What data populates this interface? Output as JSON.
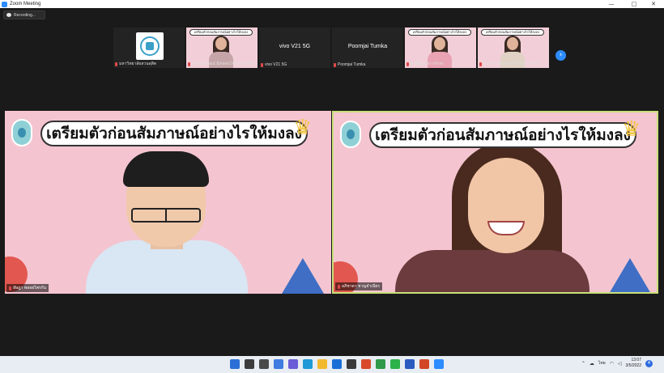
{
  "window": {
    "title": "Zoom Meeting",
    "min": "—",
    "max": "□",
    "close": "✕"
  },
  "recording": {
    "label": "Recording..."
  },
  "thumbnails": [
    {
      "type": "logo",
      "name": "มหาวิทยาลัยสวนดุสิต"
    },
    {
      "type": "video",
      "name": "ผศ.นันทพัฒน์ มีสุขสมโพธิ-สวนดุสิต",
      "banner": "เตรียมตัวก่อนสัมภาษณ์อย่างไรให้ลงลง"
    },
    {
      "type": "text",
      "center": "vivo V21 5G",
      "name": "vivo V21 5G"
    },
    {
      "type": "text",
      "center": "Poomjai Tumka",
      "name": "Poomjai Tumka"
    },
    {
      "type": "video",
      "name": "พรพิชญา ดวงจิรพร",
      "banner": "เตรียมตัวก่อนสัมภาษณ์อย่างไรให้ลงลง"
    },
    {
      "type": "video",
      "name": "นางสาวเพ็ญพิชชา ชาญวิจารณ์",
      "banner": "เตรียมตัวก่อนสัมภาษณ์อย่างไรให้ลงลง"
    }
  ],
  "next_icon": "›",
  "speakers": [
    {
      "banner": "เตรียมตัวก่อนสัมภาษณ์อย่างไรให้มงลง",
      "name": "อัษฎา พลอยไพรกัน"
    },
    {
      "banner": "เตรียมตัวก่อนสัมภาษณ์อย่างไรให้มงลง",
      "name": "อภิชาดา ชาญจำเนียร"
    }
  ],
  "crown": "♛",
  "taskbar": {
    "icons": [
      {
        "name": "windows-start-icon",
        "color": "#2b6fd6"
      },
      {
        "name": "search-icon",
        "color": "#3c3c3c"
      },
      {
        "name": "task-view-icon",
        "color": "#4a4a4a"
      },
      {
        "name": "widgets-icon",
        "color": "#3f7be0"
      },
      {
        "name": "chat-icon",
        "color": "#6a5bd6"
      },
      {
        "name": "edge-icon",
        "color": "#1f9ad6"
      },
      {
        "name": "file-explorer-icon",
        "color": "#f2b92d"
      },
      {
        "name": "mail-icon",
        "color": "#1a6fd6"
      },
      {
        "name": "store-icon",
        "color": "#3a3a3a"
      },
      {
        "name": "office-icon",
        "color": "#d84a2a"
      },
      {
        "name": "chrome-icon",
        "color": "#2f9a4a"
      },
      {
        "name": "line-icon",
        "color": "#2cb34a"
      },
      {
        "name": "word-icon",
        "color": "#2a5bbf"
      },
      {
        "name": "powerpoint-icon",
        "color": "#d24726"
      },
      {
        "name": "zoom-icon",
        "color": "#2d8cff"
      }
    ],
    "language": "ไทย",
    "time": "13:07",
    "date": "3/5/2022",
    "notifications": "4"
  }
}
